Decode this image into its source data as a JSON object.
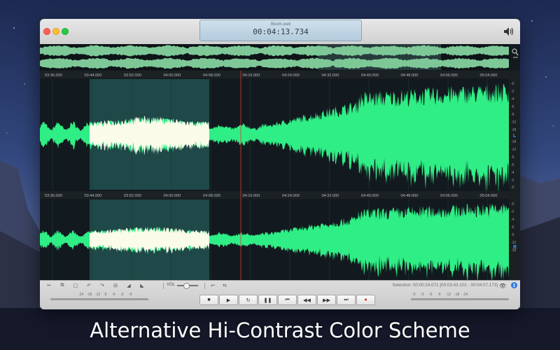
{
  "window": {
    "filename": "Boom.swd",
    "time": "00:04:13.734",
    "volume_icon": "speaker-icon"
  },
  "overview": {
    "zoom_icon": "zoom-icon"
  },
  "timeline": {
    "ticks": [
      "03:36.000",
      "03:44.000",
      "03:52.000",
      "04:00.000",
      "04:08.000",
      "04:16.000",
      "04:24.000",
      "04:32.000",
      "04:40.000",
      "04:48.000",
      "04:56.000",
      "05:04.000"
    ]
  },
  "channels": {
    "left": {
      "label": "L"
    },
    "right": {
      "label": "R"
    },
    "db_scale": [
      "-0",
      "-2",
      "-4",
      "-6",
      "-9",
      "-12",
      "-18",
      "-18",
      "-12",
      "-9",
      "-6",
      "-4",
      "-2",
      "-0"
    ]
  },
  "colors": {
    "waveform": "#2fee85",
    "selection_waveform": "#fbfbea",
    "selection_bg": "#1f4848",
    "playhead": "#e0362c",
    "background": "#131a1f",
    "grid": "#1e3a33"
  },
  "toolbar": {
    "tools": [
      "cut-icon",
      "copy-icon",
      "paste-icon",
      "undo-icon",
      "redo-icon",
      "trim-icon",
      "fade-in-icon",
      "fade-out-icon"
    ],
    "vol_label": "VOL",
    "selection": "Selection: 00:00:24.071 [00:03:43.102 - 00:04:07.173]",
    "eye_icon": "eye-icon",
    "info": "i"
  },
  "meters": {
    "left_labels": [
      "-24",
      "-18",
      "-12",
      "-9",
      "-6",
      "-3",
      "-0"
    ],
    "right_labels": [
      "-0",
      "-3",
      "-6",
      "-9",
      "-12",
      "-18",
      "-24"
    ]
  },
  "transport": [
    {
      "name": "stop",
      "glyph": "■"
    },
    {
      "name": "play",
      "glyph": "▶"
    },
    {
      "name": "loop",
      "glyph": "↻"
    },
    {
      "name": "pause",
      "glyph": "❚❚"
    },
    {
      "name": "go-start",
      "glyph": "⏮"
    },
    {
      "name": "rewind",
      "glyph": "◀◀"
    },
    {
      "name": "fast-forward",
      "glyph": "▶▶"
    },
    {
      "name": "go-end",
      "glyph": "⏭"
    },
    {
      "name": "record",
      "glyph": "●"
    }
  ],
  "caption": "Alternative Hi-Contrast Color Scheme"
}
